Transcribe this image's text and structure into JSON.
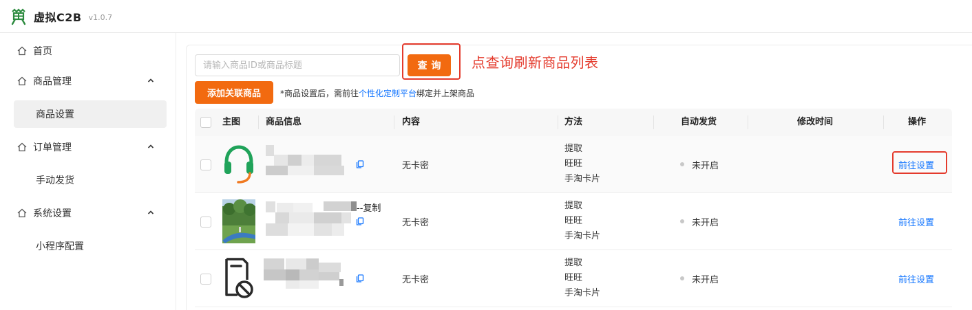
{
  "app": {
    "title": "虚拟C2B",
    "version": "v1.0.7"
  },
  "sidebar": {
    "home": "首页",
    "product_mgmt": "商品管理",
    "product_settings": "商品设置",
    "order_mgmt": "订单管理",
    "manual_delivery": "手动发货",
    "system_settings": "系统设置",
    "mini_program": "小程序配置"
  },
  "search": {
    "placeholder": "请输入商品ID或商品标题",
    "value": ""
  },
  "buttons": {
    "query": "查询",
    "add_linked": "添加关联商品"
  },
  "annotation": "点查询刷新商品列表",
  "notice": {
    "before": "*商品设置后，需前往",
    "link": "个性化定制平台",
    "after": "绑定并上架商品"
  },
  "table": {
    "headers": {
      "image": "主图",
      "info": "商品信息",
      "content": "内容",
      "method": "方法",
      "auto_ship": "自动发货",
      "modified": "修改时间",
      "actions": "操作"
    },
    "rows": [
      {
        "thumb": "headset-icon",
        "info_suffix": "",
        "content": "无卡密",
        "methods": [
          "提取",
          "旺旺",
          "手淘卡片"
        ],
        "auto_ship": "未开启",
        "modified": "",
        "action": "前往设置"
      },
      {
        "thumb": "park-photo",
        "info_suffix": "--复制",
        "content": "无卡密",
        "methods": [
          "提取",
          "旺旺",
          "手淘卡片"
        ],
        "auto_ship": "未开启",
        "modified": "",
        "action": "前往设置"
      },
      {
        "thumb": "blocked-document-icon",
        "info_suffix": "",
        "content": "无卡密",
        "methods": [
          "提取",
          "旺旺",
          "手淘卡片"
        ],
        "auto_ship": "未开启",
        "modified": "",
        "action": "前往设置"
      }
    ]
  },
  "colors": {
    "accent": "#f26a10",
    "annotation_red": "#e43a2c",
    "link_blue": "#1677ff",
    "logo_green": "#2b8a3e"
  }
}
